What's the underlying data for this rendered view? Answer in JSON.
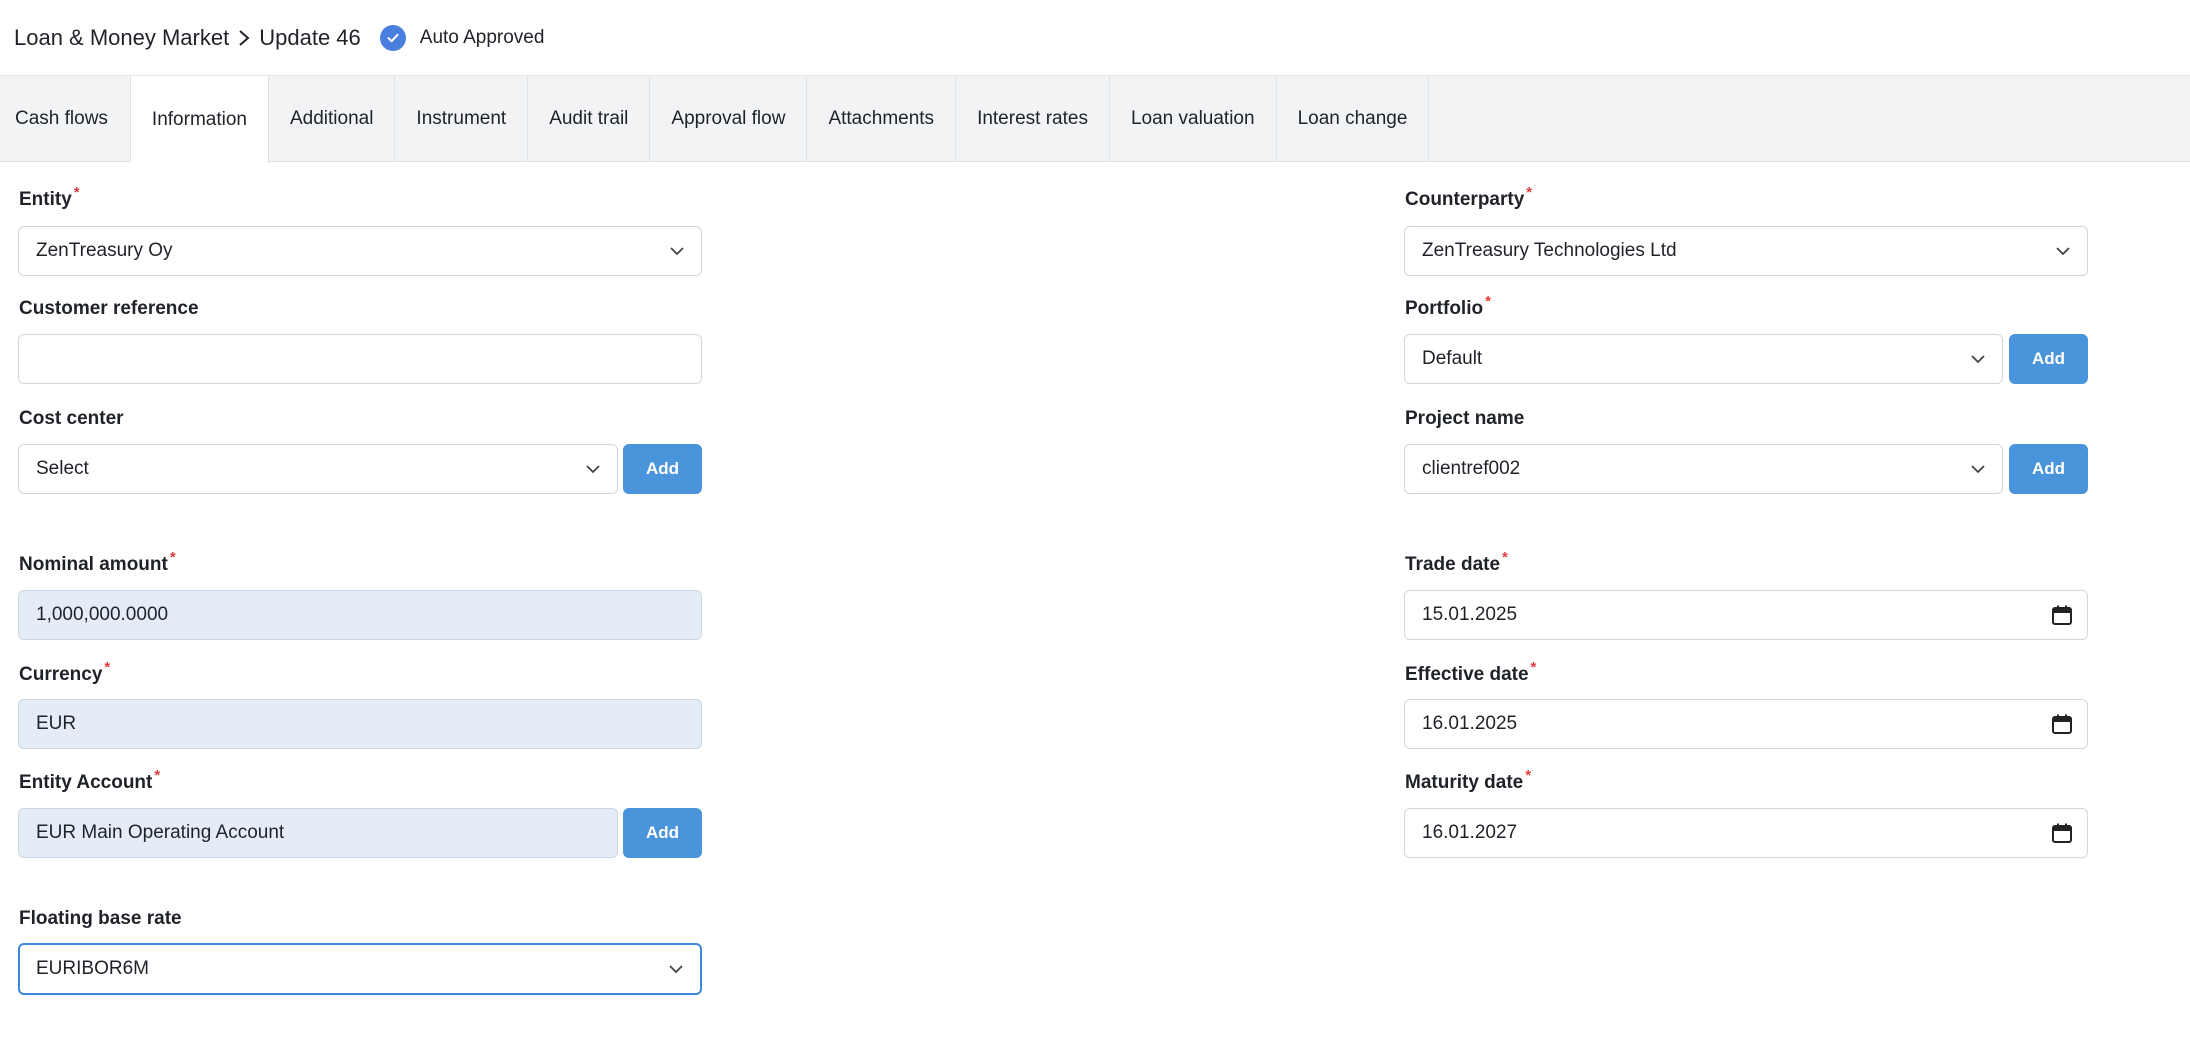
{
  "breadcrumb": {
    "section": "Loan & Money Market",
    "page": "Update 46"
  },
  "status": {
    "label": "Auto Approved",
    "color": "#4a7fe0"
  },
  "tabs": [
    {
      "label": "Cash flows"
    },
    {
      "label": "Information"
    },
    {
      "label": "Additional"
    },
    {
      "label": "Instrument"
    },
    {
      "label": "Audit trail"
    },
    {
      "label": "Approval flow"
    },
    {
      "label": "Attachments"
    },
    {
      "label": "Interest rates"
    },
    {
      "label": "Loan valuation"
    },
    {
      "label": "Loan change"
    }
  ],
  "active_tab": "Information",
  "form": {
    "entity": {
      "label": "Entity",
      "required": "*",
      "value": "ZenTreasury Oy"
    },
    "customer_reference": {
      "label": "Customer reference",
      "value": ""
    },
    "cost_center": {
      "label": "Cost center",
      "value": "Select",
      "add_label": "Add"
    },
    "nominal_amount": {
      "label": "Nominal amount",
      "required": "*",
      "value": "1,000,000.0000"
    },
    "currency": {
      "label": "Currency",
      "required": "*",
      "value": "EUR"
    },
    "entity_account": {
      "label": "Entity Account",
      "required": "*",
      "value": "EUR Main Operating Account",
      "add_label": "Add"
    },
    "floating_base_rate": {
      "label": "Floating base rate",
      "value": "EURIBOR6M"
    },
    "counterparty": {
      "label": "Counterparty",
      "required": "*",
      "value": "ZenTreasury Technologies Ltd"
    },
    "portfolio": {
      "label": "Portfolio",
      "required": "*",
      "value": "Default",
      "add_label": "Add"
    },
    "project_name": {
      "label": "Project name",
      "value": "clientref002",
      "add_label": "Add"
    },
    "trade_date": {
      "label": "Trade date",
      "required": "*",
      "value": "15.01.2025"
    },
    "effective_date": {
      "label": "Effective date",
      "required": "*",
      "value": "16.01.2025"
    },
    "maturity_date": {
      "label": "Maturity date",
      "required": "*",
      "value": "16.01.2027"
    }
  },
  "colors": {
    "accent": "#4a94dc",
    "required": "#e03c3c",
    "readonly_bg": "#e4edf7"
  }
}
